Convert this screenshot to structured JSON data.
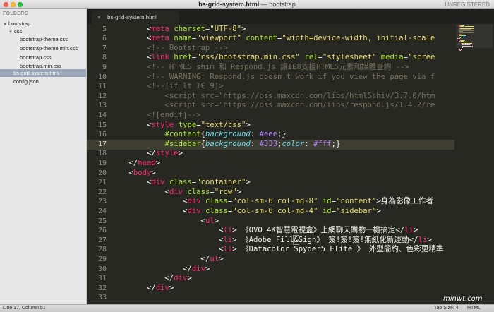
{
  "window": {
    "title_file": "bs-grid-system.html",
    "title_rest": " — bootstrap",
    "unregistered": "UNREGISTERED"
  },
  "sidebar": {
    "header": "FOLDERS",
    "items": [
      {
        "label": "bootstrap",
        "arrow": "▼"
      },
      {
        "label": "css",
        "arrow": "▼"
      },
      {
        "label": "bootstrap-theme.css"
      },
      {
        "label": "bootstrap-theme.min.css"
      },
      {
        "label": "bootstrap.css"
      },
      {
        "label": "bootstrap.min.css"
      },
      {
        "label": "bs-grid-system.html"
      },
      {
        "label": "config.json"
      }
    ]
  },
  "tab": {
    "label": "bs-grid-system.html",
    "close": "×"
  },
  "editor": {
    "lines": [
      {
        "n": "5",
        "tokens": [
          [
            "p",
            "        "
          ],
          [
            "p",
            "<"
          ],
          [
            "t",
            "meta"
          ],
          [
            "p",
            " "
          ],
          [
            "a",
            "charset"
          ],
          [
            "p",
            "="
          ],
          [
            "s",
            "\"UTF-8\""
          ],
          [
            "p",
            ">"
          ]
        ]
      },
      {
        "n": "6",
        "tokens": [
          [
            "p",
            "        <"
          ],
          [
            "t",
            "meta"
          ],
          [
            "p",
            " "
          ],
          [
            "a",
            "name"
          ],
          [
            "p",
            "="
          ],
          [
            "s",
            "\"viewport\""
          ],
          [
            "p",
            " "
          ],
          [
            "a",
            "content"
          ],
          [
            "p",
            "="
          ],
          [
            "s",
            "\"width=device-width, initial-scale"
          ]
        ]
      },
      {
        "n": "7",
        "tokens": [
          [
            "c",
            "        <!-- Bootstrap -->"
          ]
        ]
      },
      {
        "n": "8",
        "tokens": [
          [
            "p",
            "        <"
          ],
          [
            "t",
            "link"
          ],
          [
            "p",
            " "
          ],
          [
            "a",
            "href"
          ],
          [
            "p",
            "="
          ],
          [
            "s",
            "\"css/bootstrap.min.css\""
          ],
          [
            "p",
            " "
          ],
          [
            "a",
            "rel"
          ],
          [
            "p",
            "="
          ],
          [
            "s",
            "\"stylesheet\""
          ],
          [
            "p",
            " "
          ],
          [
            "a",
            "media"
          ],
          [
            "p",
            "="
          ],
          [
            "s",
            "\"scree"
          ]
        ]
      },
      {
        "n": "9",
        "tokens": [
          [
            "c",
            "        <!-- HTML5 shim 和 Respond.js 讓IE8支援HTML5元素和媒體查詢 -->"
          ]
        ]
      },
      {
        "n": "10",
        "tokens": [
          [
            "c",
            "        <!-- WARNING: Respond.js doesn't work if you view the page via f"
          ]
        ]
      },
      {
        "n": "11",
        "tokens": [
          [
            "c",
            "        <!--[if lt IE 9]>"
          ]
        ]
      },
      {
        "n": "12",
        "tokens": [
          [
            "c",
            "            <script src=\"https://oss.maxcdn.com/libs/html5shiv/3.7.0/htm"
          ]
        ]
      },
      {
        "n": "13",
        "tokens": [
          [
            "c",
            "            <script src=\"https://oss.maxcdn.com/libs/respond.js/1.4.2/re"
          ]
        ]
      },
      {
        "n": "14",
        "tokens": [
          [
            "c",
            "        <![endif]-->"
          ]
        ]
      },
      {
        "n": "15",
        "tokens": [
          [
            "p",
            "        <"
          ],
          [
            "t",
            "style"
          ],
          [
            "p",
            " "
          ],
          [
            "a",
            "type"
          ],
          [
            "p",
            "="
          ],
          [
            "s",
            "\"text/css\""
          ],
          [
            "p",
            ">"
          ]
        ]
      },
      {
        "n": "16",
        "tokens": [
          [
            "p",
            "            "
          ],
          [
            "a",
            "#content"
          ],
          [
            "p",
            "{"
          ],
          [
            "v",
            "background"
          ],
          [
            "p",
            ": "
          ],
          [
            "n",
            "#eee"
          ],
          [
            "p",
            ";}"
          ]
        ]
      },
      {
        "n": "17",
        "tokens": [
          [
            "p",
            "            "
          ],
          [
            "a",
            "#sidebar"
          ],
          [
            "p",
            "{"
          ],
          [
            "v",
            "background"
          ],
          [
            "p",
            ": "
          ],
          [
            "n",
            "#333"
          ],
          [
            "p",
            ";"
          ],
          [
            "v",
            "color"
          ],
          [
            "p",
            ": "
          ],
          [
            "n",
            "#fff"
          ],
          [
            "p",
            ";}"
          ]
        ]
      },
      {
        "n": "18",
        "tokens": [
          [
            "p",
            "        </"
          ],
          [
            "t",
            "style"
          ],
          [
            "p",
            ">"
          ]
        ]
      },
      {
        "n": "19",
        "tokens": [
          [
            "p",
            "    </"
          ],
          [
            "t",
            "head"
          ],
          [
            "p",
            ">"
          ]
        ]
      },
      {
        "n": "20",
        "tokens": [
          [
            "p",
            "    <"
          ],
          [
            "t",
            "body"
          ],
          [
            "p",
            ">"
          ]
        ]
      },
      {
        "n": "21",
        "tokens": [
          [
            "p",
            "        <"
          ],
          [
            "t",
            "div"
          ],
          [
            "p",
            " "
          ],
          [
            "a",
            "class"
          ],
          [
            "p",
            "="
          ],
          [
            "s",
            "\"container\""
          ],
          [
            "p",
            ">"
          ]
        ]
      },
      {
        "n": "22",
        "tokens": [
          [
            "p",
            "            <"
          ],
          [
            "t",
            "div"
          ],
          [
            "p",
            " "
          ],
          [
            "a",
            "class"
          ],
          [
            "p",
            "="
          ],
          [
            "s",
            "\"row\""
          ],
          [
            "p",
            ">"
          ]
        ]
      },
      {
        "n": "23",
        "tokens": [
          [
            "p",
            "                <"
          ],
          [
            "t",
            "div"
          ],
          [
            "p",
            " "
          ],
          [
            "a",
            "class"
          ],
          [
            "p",
            "="
          ],
          [
            "s",
            "\"col-sm-6 col-md-8\""
          ],
          [
            "p",
            " "
          ],
          [
            "a",
            "id"
          ],
          [
            "p",
            "="
          ],
          [
            "s",
            "\"content\""
          ],
          [
            "p",
            ">身為影像工作者"
          ]
        ]
      },
      {
        "n": "24",
        "tokens": [
          [
            "p",
            "                <"
          ],
          [
            "t",
            "div"
          ],
          [
            "p",
            " "
          ],
          [
            "a",
            "class"
          ],
          [
            "p",
            "="
          ],
          [
            "s",
            "\"col-sm-6 col-md-4\""
          ],
          [
            "p",
            " "
          ],
          [
            "a",
            "id"
          ],
          [
            "p",
            "="
          ],
          [
            "s",
            "\"sidebar\""
          ],
          [
            "p",
            ">"
          ]
        ]
      },
      {
        "n": "25",
        "tokens": [
          [
            "p",
            "                    <"
          ],
          [
            "t",
            "ul"
          ],
          [
            "p",
            ">"
          ]
        ]
      },
      {
        "n": "26",
        "tokens": [
          [
            "p",
            "                        <"
          ],
          [
            "t",
            "li"
          ],
          [
            "p",
            "> 《OVO 4K智慧電視盒》上網聊天購物一機搞定</"
          ],
          [
            "t",
            "li"
          ],
          [
            "p",
            ">"
          ]
        ]
      },
      {
        "n": "27",
        "tokens": [
          [
            "p",
            "                        <"
          ],
          [
            "t",
            "li"
          ],
          [
            "p",
            "> 《Adobe Fill"
          ],
          [
            "mt",
            "&"
          ],
          [
            "p",
            "Sign》 簽!簽!簽!無紙化新運動</"
          ],
          [
            "t",
            "li"
          ],
          [
            "p",
            ">"
          ]
        ]
      },
      {
        "n": "28",
        "tokens": [
          [
            "p",
            "                        <"
          ],
          [
            "t",
            "li"
          ],
          [
            "p",
            "> 《Datacolor Spyder5 Elite 》 外型簡約、色彩更精準"
          ]
        ]
      },
      {
        "n": "29",
        "tokens": [
          [
            "p",
            "                    </"
          ],
          [
            "t",
            "ul"
          ],
          [
            "p",
            ">"
          ]
        ]
      },
      {
        "n": "30",
        "tokens": [
          [
            "p",
            "                </"
          ],
          [
            "t",
            "div"
          ],
          [
            "p",
            ">"
          ]
        ]
      },
      {
        "n": "31",
        "tokens": [
          [
            "p",
            "            </"
          ],
          [
            "t",
            "div"
          ],
          [
            "p",
            ">"
          ]
        ]
      },
      {
        "n": "32",
        "tokens": [
          [
            "p",
            "        </"
          ],
          [
            "t",
            "div"
          ],
          [
            "p",
            ">"
          ]
        ]
      },
      {
        "n": "33",
        "tokens": [
          [
            "p",
            ""
          ]
        ]
      }
    ],
    "current_line": "17"
  },
  "status": {
    "position": "Line 17, Column 51",
    "tab_size": "Tab Size: 4",
    "syntax": "HTML"
  },
  "watermark": "minwt.com",
  "colors": {
    "background": "#272822",
    "tag": "#f92672",
    "attribute": "#a6e22e",
    "string": "#e6db74",
    "comment": "#75715e",
    "property": "#66d9ef",
    "number": "#ae81ff"
  }
}
